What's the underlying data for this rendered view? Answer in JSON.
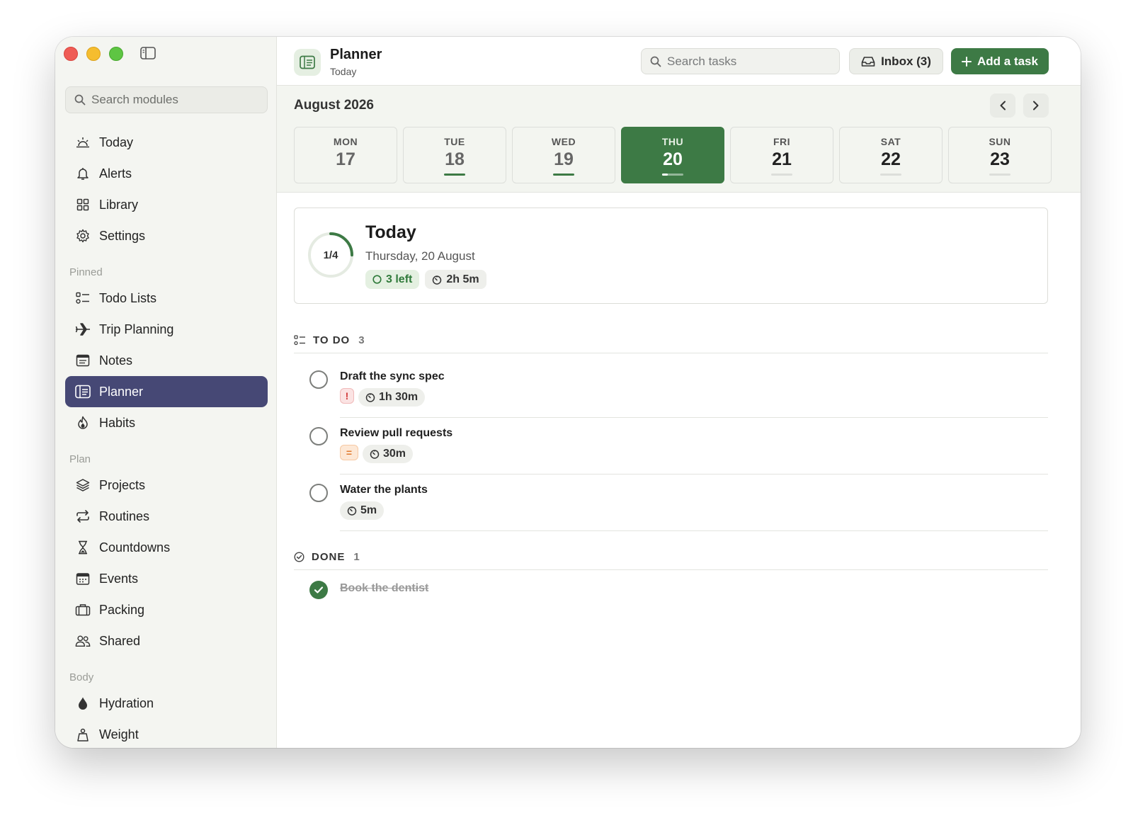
{
  "sidebar": {
    "search_placeholder": "Search modules",
    "main_items": [
      {
        "label": "Today",
        "icon": "sunrise-icon"
      },
      {
        "label": "Alerts",
        "icon": "bell-icon"
      },
      {
        "label": "Library",
        "icon": "grid-icon"
      },
      {
        "label": "Settings",
        "icon": "gear-icon"
      }
    ],
    "sections": [
      {
        "label": "Pinned",
        "items": [
          {
            "label": "Todo Lists",
            "icon": "checklist-icon"
          },
          {
            "label": "Trip Planning",
            "icon": "airplane-icon"
          },
          {
            "label": "Notes",
            "icon": "note-icon"
          },
          {
            "label": "Planner",
            "icon": "planner-icon",
            "active": true
          },
          {
            "label": "Habits",
            "icon": "flame-icon"
          }
        ]
      },
      {
        "label": "Plan",
        "items": [
          {
            "label": "Projects",
            "icon": "layers-icon"
          },
          {
            "label": "Routines",
            "icon": "repeat-icon"
          },
          {
            "label": "Countdowns",
            "icon": "hourglass-icon"
          },
          {
            "label": "Events",
            "icon": "calendar-icon"
          },
          {
            "label": "Packing",
            "icon": "suitcase-icon"
          },
          {
            "label": "Shared",
            "icon": "people-icon"
          }
        ]
      },
      {
        "label": "Body",
        "items": [
          {
            "label": "Hydration",
            "icon": "drop-icon"
          },
          {
            "label": "Weight",
            "icon": "scale-icon"
          }
        ]
      }
    ]
  },
  "header": {
    "title": "Planner",
    "subtitle": "Today",
    "search_placeholder": "Search tasks",
    "inbox_label": "Inbox (3)",
    "add_label": "Add a task"
  },
  "week": {
    "month_label": "August 2026",
    "days": [
      {
        "name": "MON",
        "num": "17",
        "state": "past",
        "bar": "none"
      },
      {
        "name": "TUE",
        "num": "18",
        "state": "past",
        "bar": "green"
      },
      {
        "name": "WED",
        "num": "19",
        "state": "past",
        "bar": "green"
      },
      {
        "name": "THU",
        "num": "20",
        "state": "today",
        "bar": "progress",
        "progress": 0.25
      },
      {
        "name": "FRI",
        "num": "21",
        "state": "future",
        "bar": "grey"
      },
      {
        "name": "SAT",
        "num": "22",
        "state": "future",
        "bar": "grey"
      },
      {
        "name": "SUN",
        "num": "23",
        "state": "future",
        "bar": "grey"
      }
    ]
  },
  "summary": {
    "progress_label": "1/4",
    "progress": 0.25,
    "title": "Today",
    "date": "Thursday, 20 August",
    "left_label": "3 left",
    "time_label": "2h 5m"
  },
  "todo": {
    "label": "TO DO",
    "count": "3",
    "tasks": [
      {
        "title": "Draft the sync spec",
        "priority": "high",
        "priority_symbol": "!",
        "duration": "1h 30m"
      },
      {
        "title": "Review pull requests",
        "priority": "medium",
        "priority_symbol": "=",
        "duration": "30m"
      },
      {
        "title": "Water the plants",
        "priority": "none",
        "priority_symbol": "",
        "duration": "5m"
      }
    ]
  },
  "done": {
    "label": "DONE",
    "count": "1",
    "tasks": [
      {
        "title": "Book the dentist"
      }
    ]
  },
  "colors": {
    "accent_green": "#3d7a45",
    "sidebar_active": "#464875"
  }
}
